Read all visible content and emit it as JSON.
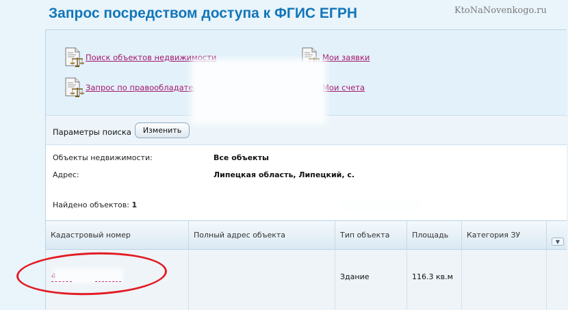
{
  "page": {
    "title": "Запрос посредством доступа к ФГИС ЕГРН",
    "watermark": "KtoNaNovenkogo.ru"
  },
  "links": [
    {
      "label": "Поиск объектов недвижимости",
      "icon": "document-scales-icon"
    },
    {
      "label": "Мои заявки",
      "icon": "document-scales-icon"
    },
    {
      "label": "Запрос по правообладателю",
      "icon": "document-scales-icon"
    },
    {
      "label": "Мои счета",
      "icon": "document-scales-icon"
    }
  ],
  "search_params": {
    "label": "Параметры поиска",
    "change_button": "Изменить",
    "rows": [
      {
        "label": "Объекты недвижимости:",
        "value": "Все объекты"
      },
      {
        "label": "Адрес:",
        "value": "Липецкая область, Липецкий, с."
      }
    ]
  },
  "results": {
    "found_label": "Найдено объектов:",
    "found_count": "1",
    "columns": [
      "Кадастровый номер",
      "Полный адрес объекта",
      "Тип объекта",
      "Площадь",
      "Категория ЗУ"
    ],
    "sort_icon": "chevron-down-icon",
    "rows": [
      {
        "cadastral_number": "4",
        "address": "",
        "type": "Здание",
        "area": "116.3 кв.м",
        "category": ""
      }
    ]
  },
  "colors": {
    "title": "#1276b8",
    "link": "#a3186d",
    "highlight_ellipse": "#e31b23",
    "panel_bg": "#e3f1fa"
  }
}
